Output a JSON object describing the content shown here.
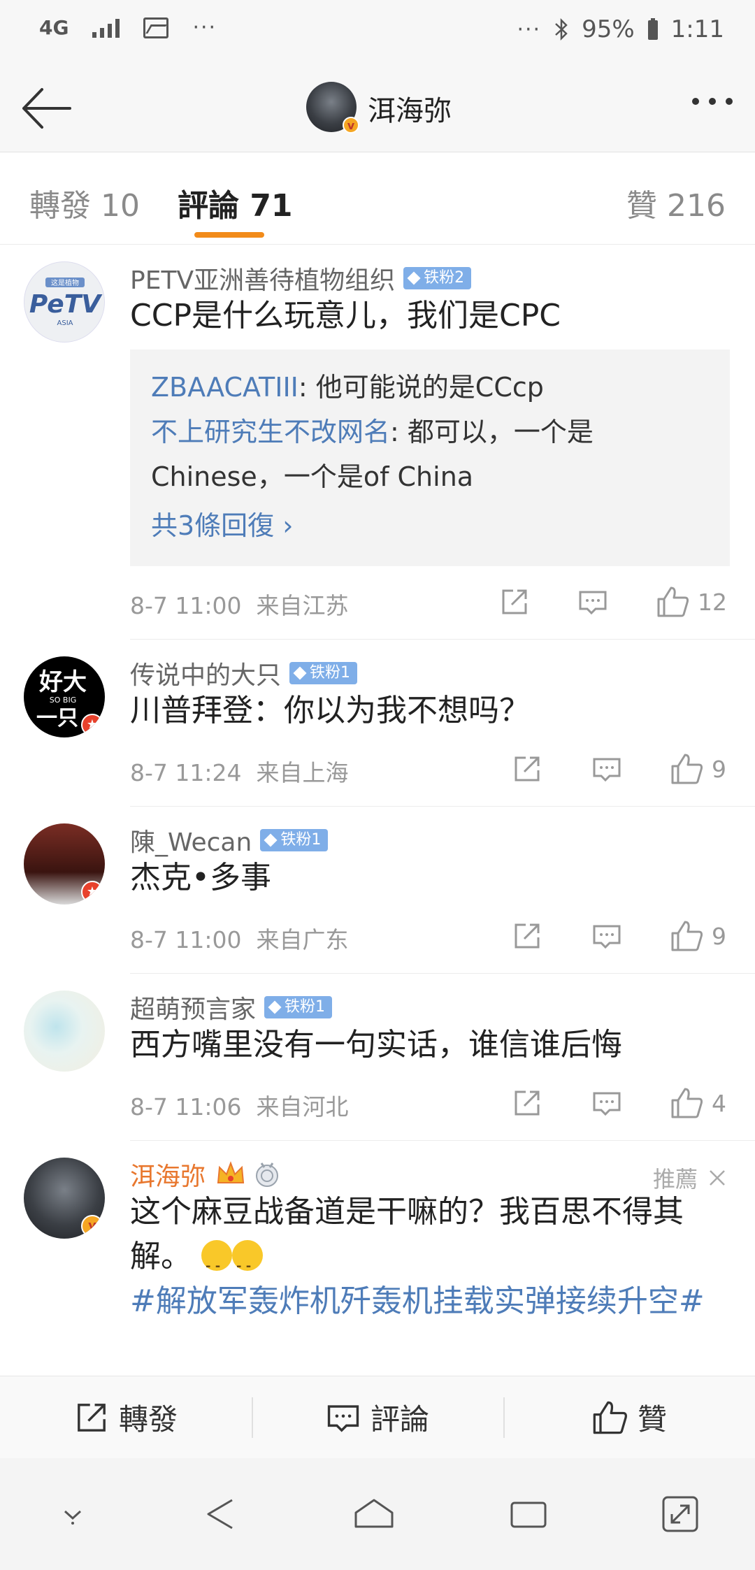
{
  "status_bar": {
    "network": "4G",
    "left_dots": "···",
    "right_dots": "···",
    "battery": "95%",
    "time": "1:11"
  },
  "header": {
    "title": "洱海弥"
  },
  "tabs": [
    {
      "label": "轉發 10"
    },
    {
      "label": "評論 71"
    },
    {
      "label": "贊 216"
    }
  ],
  "comments": [
    {
      "user": "PETV亚洲善待植物组织",
      "badge": "铁粉2",
      "text": "CCP是什么玩意儿，我们是CPC",
      "replies": [
        {
          "name": "ZBAACATIII",
          "text": ": 他可能说的是CCcp"
        },
        {
          "name": "不上研究生不改网名",
          "text": ": 都可以，一个是Chinese，一个是of China"
        }
      ],
      "more_replies": "共3條回復 ›",
      "time": "8-7 11:00",
      "location": "来自江苏",
      "likes": "12"
    },
    {
      "user": "传说中的大只",
      "badge": "铁粉1",
      "text": "川普拜登：你以为我不想吗？",
      "time": "8-7 11:24",
      "location": "来自上海",
      "likes": "9"
    },
    {
      "user": "陳_Wecan",
      "badge": "铁粉1",
      "text": "杰克•多事",
      "time": "8-7 11:00",
      "location": "来自广东",
      "likes": "9"
    },
    {
      "user": "超萌预言家",
      "badge": "铁粉1",
      "text": "西方嘴里没有一句实话，谁信谁后悔",
      "time": "8-7 11:06",
      "location": "来自河北",
      "likes": "4"
    },
    {
      "user": "洱海弥",
      "recommend": "推薦",
      "text": "这个麻豆战备道是干嘛的？我百思不得其解。",
      "hashtag": "#解放军轰炸机歼轰机挂载实弹接续升空#"
    }
  ],
  "avatar_text": {
    "petv_top": "这是植物",
    "petv_main": "PeTV",
    "petv_sub": "ASIA",
    "daizhi_1": "好大",
    "daizhi_2": "SO BIG",
    "daizhi_3": "一只"
  },
  "action_bar": {
    "repost": "轉發",
    "comment": "評論",
    "like": "贊"
  },
  "colors": {
    "accent": "#f28b1a",
    "link": "#4e7cb8",
    "badge": "#7faee8",
    "author": "#e8772e"
  }
}
